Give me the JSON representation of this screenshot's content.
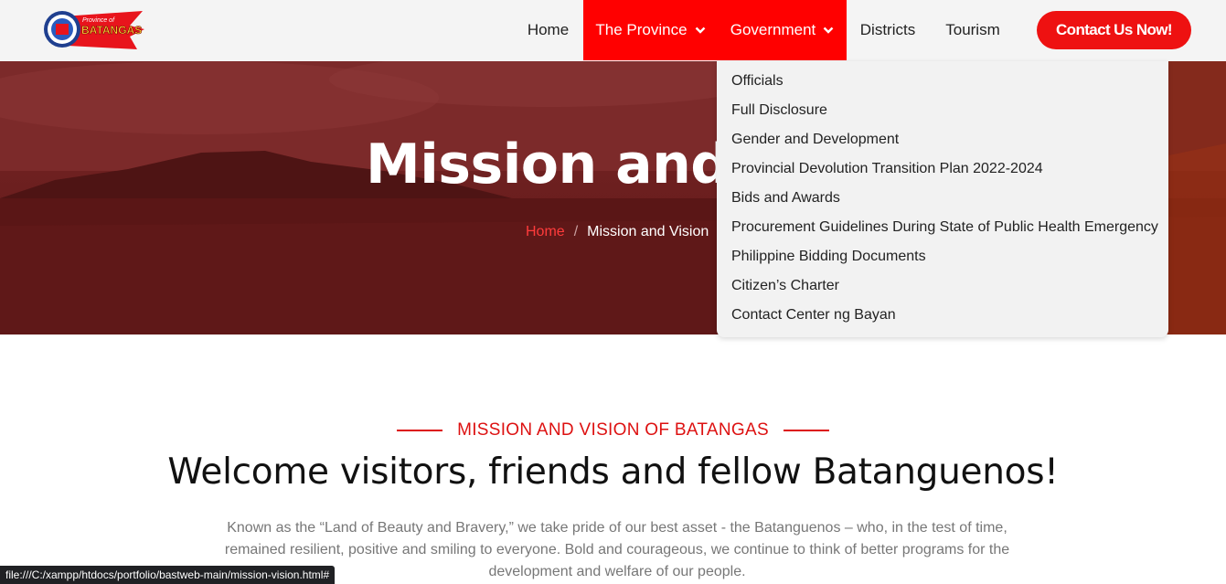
{
  "nav": {
    "logo_text_small": "Province of",
    "logo_text_big": "BATANGAS",
    "items": [
      {
        "label": "Home"
      },
      {
        "label": "The Province"
      },
      {
        "label": "Government"
      },
      {
        "label": "Districts"
      },
      {
        "label": "Tourism"
      }
    ],
    "contact_label": "Contact Us Now!"
  },
  "hero": {
    "title": "Mission and Vision",
    "breadcrumb_home": "Home",
    "breadcrumb_sep": "/",
    "breadcrumb_current": "Mission and Vision"
  },
  "dropdown": {
    "items": [
      "Officials",
      "Full Disclosure",
      "Gender and Development",
      "Provincial Devolution Transition Plan 2022-2024",
      "Bids and Awards",
      "Procurement Guidelines During State of Public Health Emergency",
      "Philippine Bidding Documents",
      "Citizen’s Charter",
      "Contact Center ng Bayan"
    ]
  },
  "content": {
    "section_label": "MISSION AND VISION OF BATANGAS",
    "headline": "Welcome visitors, friends and fellow Batanguenos!",
    "paragraph": "Known as the “Land of Beauty and Bravery,” we take pride of our best asset - the Batanguenos – who, in the test of time, remained resilient, positive and smiling to everyone. Bold and courageous, we continue to think of better programs for the development and welfare of our people."
  },
  "statusbar": {
    "url": "file:///C:/xampp/htdocs/portfolio/bastweb-main/mission-vision.html#"
  },
  "colors": {
    "accent": "#ff0000",
    "nav_bg": "#f4f4f4",
    "hero_overlay": "#6e2020"
  }
}
